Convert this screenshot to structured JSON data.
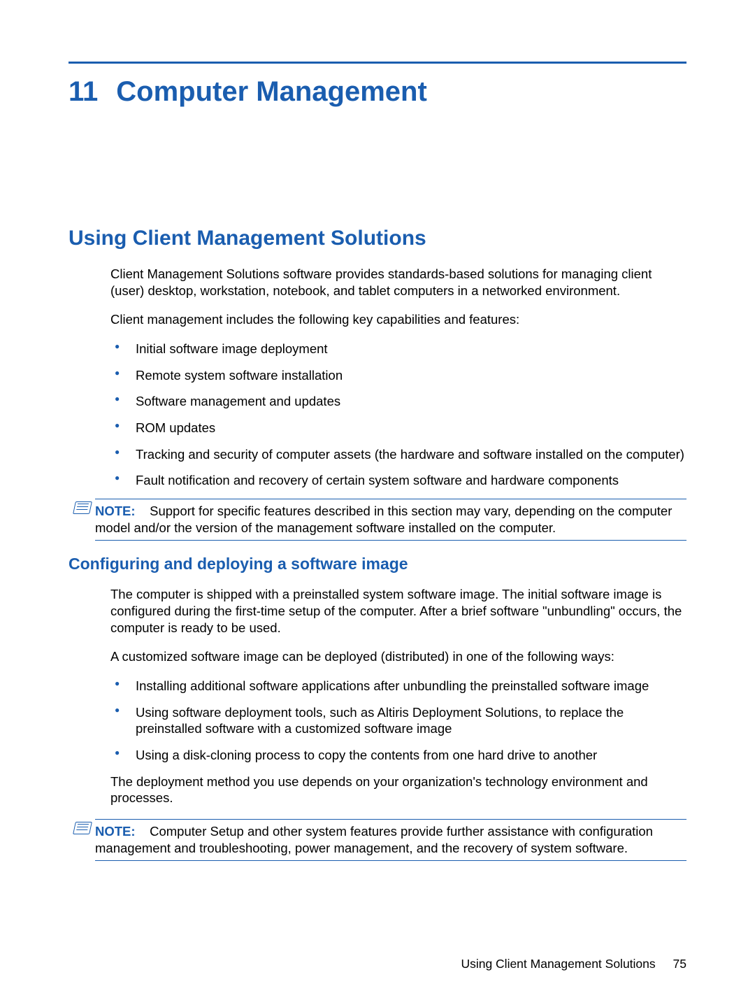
{
  "chapter": {
    "number": "11",
    "title": "Computer Management"
  },
  "section1": {
    "heading": "Using Client Management Solutions",
    "p1": "Client Management Solutions software provides standards-based solutions for managing client (user) desktop, workstation, notebook, and tablet computers in a networked environment.",
    "p2": "Client management includes the following key capabilities and features:",
    "bullets": [
      "Initial software image deployment",
      "Remote system software installation",
      "Software management and updates",
      "ROM updates",
      "Tracking and security of computer assets (the hardware and software installed on the computer)",
      "Fault notification and recovery of certain system software and hardware components"
    ],
    "note": {
      "label": "NOTE:",
      "text": "Support for specific features described in this section may vary, depending on the computer model and/or the version of the management software installed on the computer."
    }
  },
  "section2": {
    "heading": "Configuring and deploying a software image",
    "p1": "The computer is shipped with a preinstalled system software image. The initial software image is configured during the first-time setup of the computer. After a brief software \"unbundling\" occurs, the computer is ready to be used.",
    "p2": "A customized software image can be deployed (distributed) in one of the following ways:",
    "bullets": [
      "Installing additional software applications after unbundling the preinstalled software image",
      "Using software deployment tools, such as Altiris Deployment Solutions, to replace the preinstalled software with a customized software image",
      "Using a disk-cloning process to copy the contents from one hard drive to another"
    ],
    "p3": "The deployment method you use depends on your organization's technology environment and processes.",
    "note": {
      "label": "NOTE:",
      "text": "Computer Setup and other system features provide further assistance with configuration management and troubleshooting, power management, and the recovery of system software."
    }
  },
  "footer": {
    "text": "Using Client Management Solutions",
    "page": "75"
  }
}
